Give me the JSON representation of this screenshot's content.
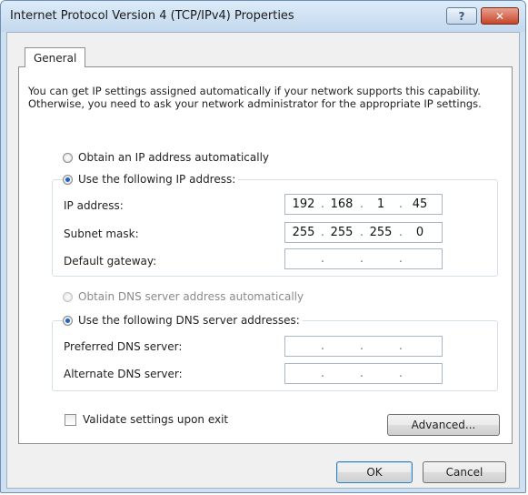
{
  "window": {
    "title": "Internet Protocol Version 4 (TCP/IPv4) Properties",
    "help_button": "?",
    "close_button": "✕"
  },
  "tabs": [
    {
      "label": "General",
      "active": true
    }
  ],
  "description": "You can get IP settings assigned automatically if your network supports this capability. Otherwise, you need to ask your network administrator for the appropriate IP settings.",
  "ip_section": {
    "auto_label": "Obtain an IP address automatically",
    "auto_selected": false,
    "manual_label": "Use the following IP address:",
    "manual_selected": true,
    "fields": {
      "ip_address": {
        "label": "IP address:",
        "octets": [
          "192",
          "168",
          "1",
          "45"
        ]
      },
      "subnet_mask": {
        "label": "Subnet mask:",
        "octets": [
          "255",
          "255",
          "255",
          "0"
        ]
      },
      "default_gateway": {
        "label": "Default gateway:",
        "octets": [
          "",
          "",
          "",
          ""
        ]
      }
    }
  },
  "dns_section": {
    "auto_label": "Obtain DNS server address automatically",
    "auto_selected": false,
    "auto_enabled": false,
    "manual_label": "Use the following DNS server addresses:",
    "manual_selected": true,
    "fields": {
      "preferred": {
        "label": "Preferred DNS server:",
        "octets": [
          "",
          "",
          "",
          ""
        ]
      },
      "alternate": {
        "label": "Alternate DNS server:",
        "octets": [
          "",
          "",
          "",
          ""
        ]
      }
    }
  },
  "validate": {
    "label": "Validate settings upon exit",
    "checked": false
  },
  "buttons": {
    "advanced": "Advanced...",
    "ok": "OK",
    "cancel": "Cancel"
  },
  "colors": {
    "title_bar": "#c4d9ee",
    "radio_selected": "#1d64c2",
    "close_button": "#c7442a"
  }
}
